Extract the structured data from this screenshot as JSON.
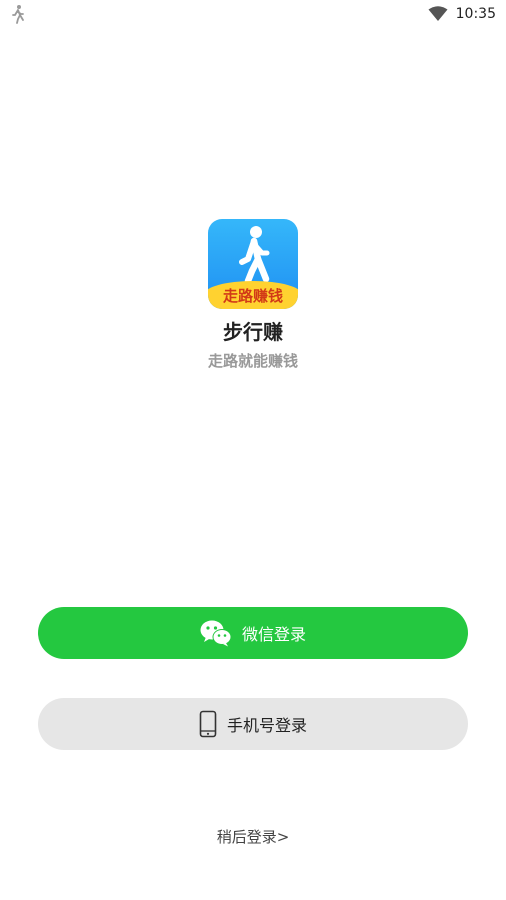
{
  "status_bar": {
    "time": "10:35",
    "left_icon": "walk-notification-icon",
    "wifi_icon": "wifi-icon"
  },
  "app": {
    "logo_text": "走路赚钱",
    "name": "步行赚",
    "slogan": "走路就能赚钱"
  },
  "buttons": {
    "wechat_label": "微信登录",
    "phone_label": "手机号登录"
  },
  "later_link": "稍后登录>",
  "colors": {
    "wechat_green": "#24c840",
    "phone_gray": "#e6e6e6",
    "logo_blue": "#2aa5f6",
    "logo_yellow": "#ffd230",
    "logo_text_red": "#d23a17"
  }
}
